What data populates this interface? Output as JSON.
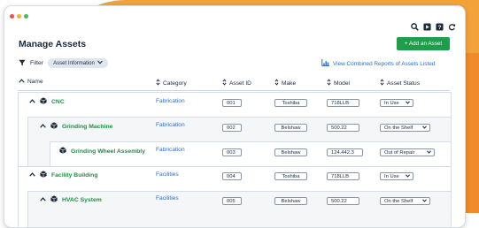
{
  "page": {
    "title": "Manage Assets",
    "add_button": "+ Add an Asset"
  },
  "filter": {
    "label": "Filter",
    "chip": "Asset Information"
  },
  "report_link": "View Combined Reports of Assets Listed",
  "columns": {
    "name": "Name",
    "category": "Category",
    "asset_id": "Asset ID",
    "make": "Make",
    "model": "Model",
    "status": "Asset Status"
  },
  "rows": [
    {
      "name": "CNC",
      "category": "Fabrication",
      "asset_id": "001",
      "make": "Toshiba",
      "model": "718LLB",
      "status": "In Use"
    },
    {
      "name": "Grinding Machine",
      "category": "Fabrication",
      "asset_id": "002",
      "make": "Belshaw",
      "model": "500.22",
      "status": "On the Shelf"
    },
    {
      "name": "Grinding Wheel Assembly",
      "category": "Fabrication",
      "asset_id": "003",
      "make": "Belshaw",
      "model": "124.442.3",
      "status": "Out of Repair"
    },
    {
      "name": "Facility Building",
      "category": "Facilities",
      "asset_id": "004",
      "make": "Toshiba",
      "model": "718LLB",
      "status": "In Use"
    },
    {
      "name": "HVAC System",
      "category": "Facilities",
      "asset_id": "005",
      "make": "Belshaw",
      "model": "500.22",
      "status": "On the Shelf"
    }
  ],
  "colors": {
    "accent_green": "#1f9d4a",
    "link_blue": "#2e6ec7",
    "background_orange": "#f3a23a"
  },
  "icons": [
    "search-icon",
    "play-icon",
    "help-icon",
    "refresh-icon",
    "filter-icon",
    "report-chart-icon",
    "chevron-up-icon",
    "cube-icon",
    "sort-icon",
    "chevron-down-icon"
  ]
}
